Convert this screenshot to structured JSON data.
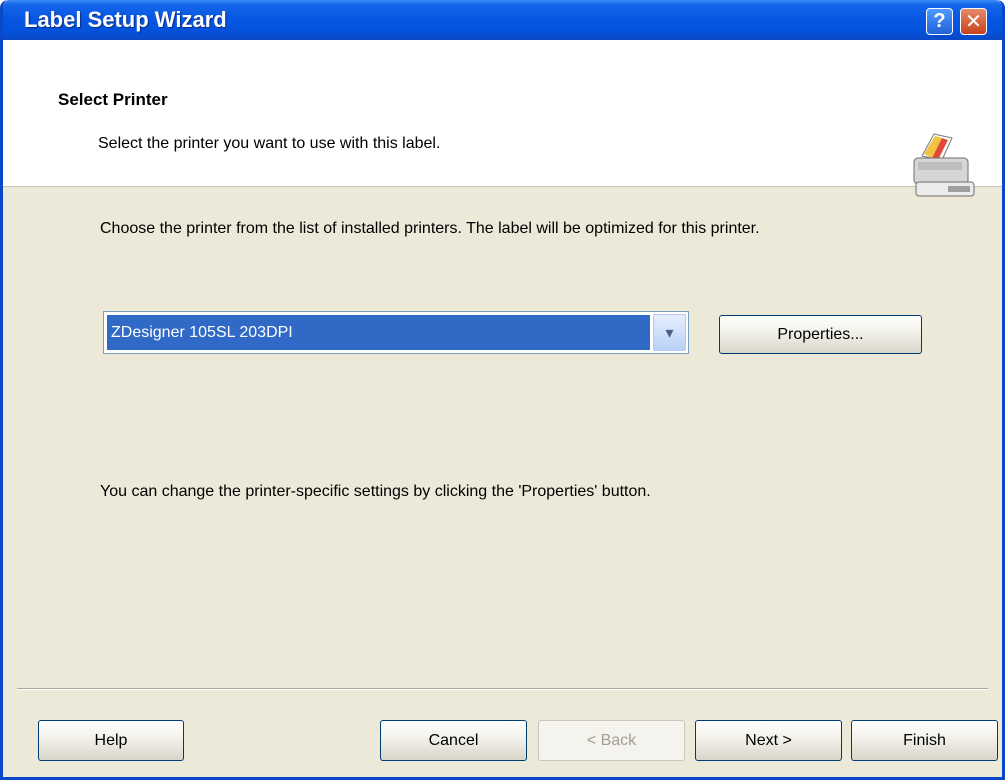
{
  "window": {
    "title": "Label Setup Wizard",
    "help_glyph": "?",
    "close_glyph": "✕"
  },
  "header": {
    "title": "Select Printer",
    "subtitle": "Select the printer you want to use with this label.",
    "icon": "printer-icon"
  },
  "body": {
    "description": "Choose the printer from the list of installed printers. The label will be optimized for this printer.",
    "printer_select": {
      "selected": "ZDesigner 105SL 203DPI",
      "arrow_glyph": "▾"
    },
    "properties_label": "Properties...",
    "hint": "You can change the printer-specific settings by clicking the 'Properties' button."
  },
  "footer": {
    "help_label": "Help",
    "cancel_label": "Cancel",
    "back_label": "< Back",
    "next_label": "Next >",
    "finish_label": "Finish"
  },
  "colors": {
    "titlebar": "#0857e3",
    "selection": "#3169c6",
    "dialog_bg": "#ece9d8"
  }
}
